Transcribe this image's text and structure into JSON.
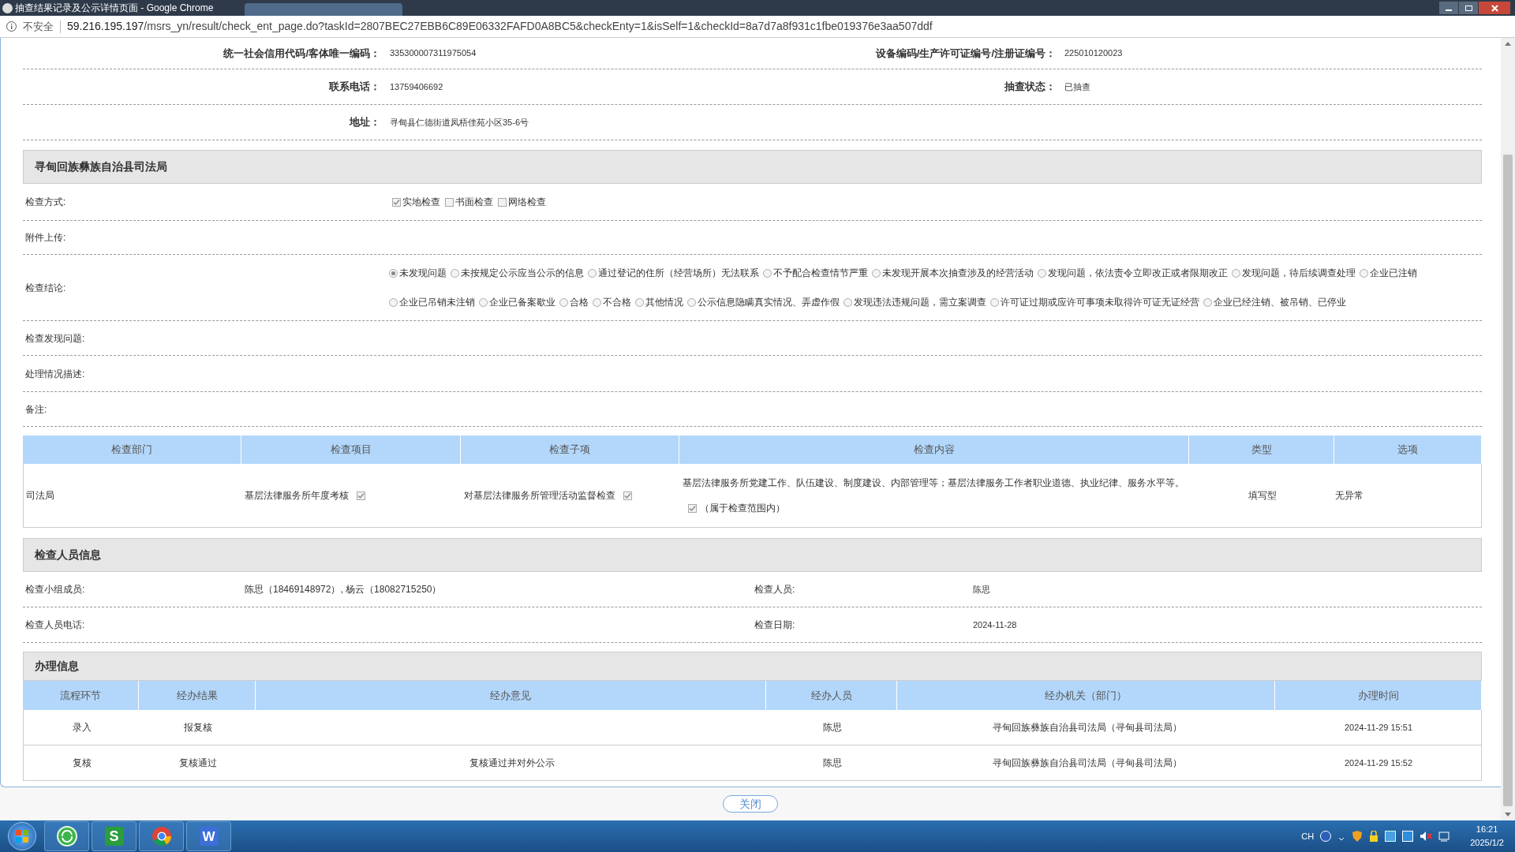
{
  "browser": {
    "title": "抽查结果记录及公示详情页面 - Google Chrome",
    "security": "不安全",
    "url_host": "59.216.195.197",
    "url_path": "/msrs_yn/result/check_ent_page.do?taskId=2807BEC27EBB6C89E06332FAFD0A8BC5&checkEnty=1&isSelf=1&checkId=8a7d7a8f931c1fbe019376e3aa507ddf"
  },
  "basic_info": [
    {
      "label": "统一社会信用代码/客体唯一编码：",
      "value": "335300007311975054",
      "label_2": "设备编码/生产许可证编号/注册证编号：",
      "value_2": "225010120023"
    },
    {
      "label": "联系电话：",
      "value": "13759406692",
      "label_2": "抽查状态：",
      "value_2": "已抽查"
    },
    {
      "label": "地址：",
      "value": "寻甸县仁德街道凤梧佳苑小区35-6号"
    }
  ],
  "department": {
    "title": "寻甸回族彝族自治县司法局",
    "check_method": {
      "label": "检查方式:",
      "options": [
        {
          "label": "实地检查",
          "checked": true
        },
        {
          "label": "书面检查",
          "checked": false
        },
        {
          "label": "网络检查",
          "checked": false
        }
      ]
    },
    "attachment_label": "附件上传:",
    "conclusion": {
      "label": "检查结论:",
      "options": [
        {
          "label": "未发现问题",
          "selected": true
        },
        {
          "label": "未按规定公示应当公示的信息",
          "selected": false
        },
        {
          "label": "通过登记的住所（经营场所）无法联系",
          "selected": false
        },
        {
          "label": "不予配合检查情节严重",
          "selected": false
        },
        {
          "label": "未发现开展本次抽查涉及的经营活动",
          "selected": false
        },
        {
          "label": "发现问题，依法责令立即改正或者限期改正",
          "selected": false
        },
        {
          "label": "发现问题，待后续调查处理",
          "selected": false
        },
        {
          "label": "企业已注销",
          "selected": false
        },
        {
          "label": "企业已吊销未注销",
          "selected": false
        },
        {
          "label": "企业已备案歇业",
          "selected": false
        },
        {
          "label": "合格",
          "selected": false
        },
        {
          "label": "不合格",
          "selected": false
        },
        {
          "label": "其他情况",
          "selected": false
        },
        {
          "label": "公示信息隐瞒真实情况、弄虚作假",
          "selected": false
        },
        {
          "label": "发现违法违规问题，需立案调查",
          "selected": false
        },
        {
          "label": "许可证过期或应许可事项未取得许可证无证经营",
          "selected": false
        },
        {
          "label": "企业已经注销、被吊销、已停业",
          "selected": false
        }
      ]
    },
    "fields": [
      "检查发现问题:",
      "处理情况描述:",
      "备注:"
    ]
  },
  "items_table": {
    "columns": [
      "检查部门",
      "检查项目",
      "检查子项",
      "检查内容",
      "类型",
      "选项"
    ],
    "rows": [
      {
        "department": "司法局",
        "item": "基层法律服务所年度考核",
        "item_checked": true,
        "subitem": "对基层法律服务所管理活动监督检查",
        "subitem_checked": true,
        "content": "基层法律服务所党建工作、队伍建设、制度建设、内部管理等；基层法律服务工作者职业道德、执业纪律、服务水平等。",
        "scope_checked": true,
        "scope": "（属于检查范围内）",
        "type": "填写型",
        "option": "无异常"
      }
    ]
  },
  "inspectors": {
    "title": "检查人员信息",
    "rows": [
      {
        "label": "检查小组成员:",
        "value": "陈思（18469148972）, 杨云（18082715250）",
        "label_2": "检查人员:",
        "value_2": "陈思"
      },
      {
        "label": "检查人员电话:",
        "label_2": "检查日期:",
        "value_2": "2024-11-28"
      }
    ]
  },
  "handling": {
    "title": "办理信息",
    "columns": [
      "流程环节",
      "经办结果",
      "经办意见",
      "经办人员",
      "经办机关（部门）",
      "办理时间"
    ],
    "rows": [
      {
        "step": "录入",
        "result": "报复核",
        "opinion": "",
        "person": "陈思",
        "office": "寻甸回族彝族自治县司法局（寻甸县司法局）",
        "time": "2024-11-29 15:51"
      },
      {
        "step": "复核",
        "result": "复核通过",
        "opinion": "复核通过并对外公示",
        "person": "陈思",
        "office": "寻甸回族彝族自治县司法局（寻甸县司法局）",
        "time": "2024-11-29 15:52"
      }
    ]
  },
  "close_button": "关闭",
  "taskbar": {
    "apps": [
      {
        "kind": "refresh"
      },
      {
        "kind": "sheet",
        "glyph": "S"
      },
      {
        "kind": "chrome"
      },
      {
        "kind": "writer",
        "glyph": "W"
      }
    ],
    "language": "CH",
    "time": "16:21",
    "date": "2025/1/2"
  }
}
